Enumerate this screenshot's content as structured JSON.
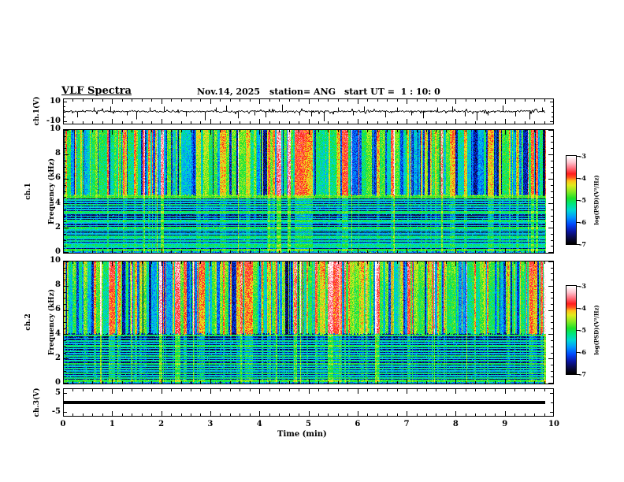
{
  "header": {
    "title": "VLF Spectra",
    "date": "Nov.14, 2025",
    "station": "station= ANG",
    "start_ut": "start UT =  1 : 10: 0"
  },
  "xaxis": {
    "label": "Time (min)",
    "tick_labels": [
      "0",
      "1",
      "2",
      "3",
      "4",
      "5",
      "6",
      "7",
      "8",
      "9",
      "10"
    ]
  },
  "panels": {
    "ch1_wave": {
      "ylabel": "ch.1(V)",
      "ytick_labels": [
        "10",
        "-10"
      ],
      "ytick_values": [
        10,
        -10
      ]
    },
    "ch1_spec": {
      "ylabel_line1": "ch.1",
      "ylabel_line2": "Frequency (kHz)",
      "ytick_labels": [
        "0",
        "2",
        "4",
        "6",
        "8",
        "10"
      ],
      "ytick_values": [
        0,
        2,
        4,
        6,
        8,
        10
      ]
    },
    "ch2_spec": {
      "ylabel_line1": "ch.2",
      "ylabel_line2": "Frequency (kHz)",
      "ytick_labels": [
        "0",
        "2",
        "4",
        "6",
        "8",
        "10"
      ],
      "ytick_values": [
        0,
        2,
        4,
        6,
        8,
        10
      ]
    },
    "ch3_wave": {
      "ylabel": "ch.3(V)",
      "ytick_labels": [
        "5",
        "-5"
      ],
      "ytick_values": [
        5,
        -5
      ]
    }
  },
  "colorbars": [
    {
      "label": "log(PSD)(V²/Hz)",
      "tick_labels": [
        "-3",
        "-4",
        "-5",
        "-6",
        "-7"
      ]
    },
    {
      "label": "log(PSD)(V²/Hz)",
      "tick_labels": [
        "-3",
        "-4",
        "-5",
        "-6",
        "-7"
      ]
    }
  ],
  "chart_data": {
    "type": "heatmap",
    "title": "VLF Spectra",
    "subtitle": "Nov.14, 2025  station= ANG  start UT = 1:10:0",
    "xlabel": "Time (min)",
    "xlim": [
      0,
      10
    ],
    "xticks": [
      0,
      1,
      2,
      3,
      4,
      5,
      6,
      7,
      8,
      9,
      10
    ],
    "x_minor_per_major": 5,
    "data_end_min": 9.84,
    "colormap": {
      "range": [
        -7,
        -3
      ],
      "stops": [
        [
          0.0,
          [
            0,
            0,
            0
          ]
        ],
        [
          0.06,
          [
            8,
            8,
            60
          ]
        ],
        [
          0.14,
          [
            10,
            20,
            160
          ]
        ],
        [
          0.22,
          [
            0,
            70,
            250
          ]
        ],
        [
          0.3,
          [
            0,
            150,
            255
          ]
        ],
        [
          0.38,
          [
            0,
            215,
            215
          ]
        ],
        [
          0.46,
          [
            0,
            230,
            120
          ]
        ],
        [
          0.52,
          [
            30,
            225,
            40
          ]
        ],
        [
          0.6,
          [
            140,
            235,
            35
          ]
        ],
        [
          0.67,
          [
            225,
            235,
            30
          ]
        ],
        [
          0.72,
          [
            255,
            190,
            25
          ]
        ],
        [
          0.76,
          [
            255,
            80,
            30
          ]
        ],
        [
          0.8,
          [
            255,
            30,
            30
          ]
        ],
        [
          0.87,
          [
            255,
            120,
            135
          ]
        ],
        [
          0.93,
          [
            255,
            195,
            205
          ]
        ],
        [
          1.0,
          [
            255,
            255,
            255
          ]
        ]
      ]
    },
    "panels": [
      {
        "type": "line",
        "name": "ch1_voltage",
        "ylabel": "ch.1(V)",
        "ylim": [
          -13.2,
          13.2
        ],
        "yticks": [
          10,
          -10
        ],
        "signal": "broadband noise ~±1 V with impulsive spikes",
        "noise_amp_v": 0.9,
        "small_spike_prob": 0.18,
        "seed": 7,
        "spikes": [
          [
            0.28,
            -6
          ],
          [
            0.62,
            4
          ],
          [
            0.95,
            5
          ],
          [
            1.3,
            -4
          ],
          [
            1.48,
            -8
          ],
          [
            1.75,
            4
          ],
          [
            2.05,
            5
          ],
          [
            2.5,
            -5
          ],
          [
            2.88,
            -9
          ],
          [
            3.1,
            4
          ],
          [
            3.32,
            6
          ],
          [
            3.56,
            -7
          ],
          [
            3.9,
            -4
          ],
          [
            4.12,
            -6
          ],
          [
            4.45,
            7
          ],
          [
            4.8,
            -4
          ],
          [
            5.05,
            -5
          ],
          [
            5.3,
            -10
          ],
          [
            5.6,
            4
          ],
          [
            5.9,
            -4
          ],
          [
            6.12,
            5
          ],
          [
            6.55,
            -6
          ],
          [
            6.8,
            4
          ],
          [
            7.08,
            -4
          ],
          [
            7.32,
            -7
          ],
          [
            7.62,
            4
          ],
          [
            7.92,
            5
          ],
          [
            8.18,
            -5
          ],
          [
            8.42,
            -9
          ],
          [
            8.65,
            -4
          ],
          [
            8.95,
            6
          ],
          [
            9.2,
            -5
          ],
          [
            9.5,
            -8
          ],
          [
            9.75,
            4
          ]
        ]
      },
      {
        "type": "heatmap",
        "name": "ch1_spectrogram",
        "ylabel": "ch.1 Frequency (kHz)",
        "ylim": [
          0,
          10
        ],
        "yticks": [
          0,
          2,
          4,
          6,
          8,
          10
        ],
        "y_minor_khz": 0.5,
        "zlabel": "log(PSD)(V²/Hz)",
        "zlim": [
          -7,
          -3
        ],
        "seed": 11,
        "sferic_band_bottom_khz": 4.7,
        "texture": {
          "red": 0.05,
          "bright": 0.22,
          "green": 0.24,
          "dim": 0.27,
          "top_boost": 0.18
        },
        "line_freqs_khz": [
          [
            4.68,
            -4.7
          ],
          [
            4.5,
            -4.9
          ],
          [
            4.3,
            -5.4
          ],
          [
            4.08,
            -5.6
          ],
          [
            3.9,
            -5.2
          ],
          [
            3.72,
            -5.6
          ],
          [
            3.5,
            -5.6
          ],
          [
            3.3,
            -5.1
          ],
          [
            3.16,
            -5.5
          ],
          [
            2.96,
            -5.3
          ],
          [
            2.78,
            -5.6
          ],
          [
            2.6,
            -5.2
          ],
          [
            2.4,
            -5.6
          ],
          [
            2.2,
            -5.4
          ],
          [
            2.02,
            -5.1
          ],
          [
            1.86,
            -5.5
          ],
          [
            1.68,
            -5.3
          ],
          [
            1.5,
            -5.6
          ],
          [
            1.3,
            -5.2
          ],
          [
            1.12,
            -5.5
          ],
          [
            0.94,
            -5.3
          ],
          [
            0.76,
            -5.6
          ],
          [
            0.58,
            -5.2
          ],
          [
            0.4,
            -5.5
          ],
          [
            0.2,
            -5.0
          ]
        ]
      },
      {
        "type": "heatmap",
        "name": "ch2_spectrogram",
        "ylabel": "ch.2 Frequency (kHz)",
        "ylim": [
          0,
          10
        ],
        "yticks": [
          0,
          2,
          4,
          6,
          8,
          10
        ],
        "y_minor_khz": 0.5,
        "zlabel": "log(PSD)(V²/Hz)",
        "zlim": [
          -7,
          -3
        ],
        "seed": 23,
        "sferic_band_bottom_khz": 4.05,
        "texture": {
          "red": 0.06,
          "bright": 0.26,
          "green": 0.26,
          "dim": 0.26,
          "top_boost": 0.28
        },
        "line_freqs_khz": [
          [
            4.4,
            -5.2
          ],
          [
            4.16,
            -5.5
          ],
          [
            3.94,
            -5.1
          ],
          [
            3.7,
            -5.5
          ],
          [
            3.48,
            -5.3
          ],
          [
            3.26,
            -5.6
          ],
          [
            3.06,
            -5.2
          ],
          [
            2.86,
            -5.5
          ],
          [
            2.64,
            -5.3
          ],
          [
            2.44,
            -5.6
          ],
          [
            2.24,
            -5.2
          ],
          [
            2.04,
            -5.5
          ],
          [
            1.84,
            -5.3
          ],
          [
            1.6,
            -5.1
          ],
          [
            1.4,
            -5.5
          ],
          [
            1.2,
            -5.3
          ],
          [
            1.0,
            -5.6
          ],
          [
            0.8,
            -5.2
          ],
          [
            0.6,
            -5.5
          ],
          [
            0.4,
            -5.3
          ],
          [
            0.2,
            -5.0
          ]
        ]
      },
      {
        "type": "line",
        "name": "ch3_voltage",
        "ylabel": "ch.3(V)",
        "ylim": [
          -7.5,
          7.5
        ],
        "yticks": [
          5,
          -5
        ],
        "signal": "constant flat line",
        "value_v": 0,
        "line_thickness_px": 4
      }
    ],
    "colorbars": [
      {
        "ticks": [
          -3,
          -4,
          -5,
          -6,
          -7
        ],
        "label": "log(PSD)(V²/Hz)"
      },
      {
        "ticks": [
          -3,
          -4,
          -5,
          -6,
          -7
        ],
        "label": "log(PSD)(V²/Hz)"
      }
    ]
  }
}
